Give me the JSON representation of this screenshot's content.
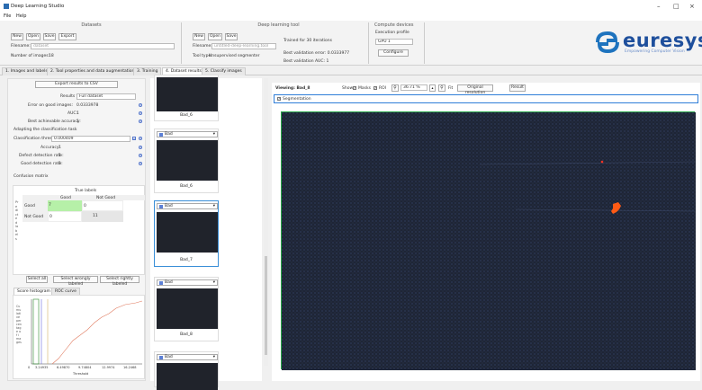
{
  "app": {
    "title": "Deep Learning Studio"
  },
  "menu": {
    "file": "File",
    "help": "Help"
  },
  "ribbon": {
    "datasets": {
      "title": "Datasets",
      "new": "New",
      "open": "Open",
      "save": "Save",
      "export": "Export",
      "filename_label": "Filename:",
      "filename_value": "dataset",
      "num_images_label": "Number of images:",
      "num_images_value": "18"
    },
    "deep": {
      "title": "Deep learning tool",
      "new": "New",
      "open": "Open",
      "save": "Save",
      "filename_label": "Filename:",
      "filename_value": "untitled-deep-learning.tool",
      "tool_type_label": "Tool type:",
      "tool_type_value": "Unsupervised segmenter",
      "trained": "Trained for 30 iterations",
      "best_error": "Best validation error: 0.0333977",
      "best_auc": "Best validation AUC: 1"
    },
    "device": {
      "title": "Compute devices",
      "exec_label": "Execution profile",
      "exec_value": "GPU 1",
      "config": "Configure"
    }
  },
  "logo": {
    "text": "euresys",
    "tagline": "Empowering Computer Vision"
  },
  "tabs": [
    "1. Images and labels",
    "2. Tool properties and data augmentation",
    "3. Training",
    "4. Dataset results",
    "5. Classify images"
  ],
  "left": {
    "export_btn": "Export results to CSV",
    "results_for_label": "Results for:",
    "results_for_value": "Full dataset",
    "err_good_label": "Error on good images:",
    "err_good_value": "0.0333978",
    "auc_label": "AUC:",
    "auc_value": "1",
    "best_score_label": "Best achievable accuracy:",
    "best_score_value": "1",
    "adapting": "Adapting the classification task",
    "thresh_label": "Classification threshold:",
    "thresh_value": "0.000409",
    "accuracy_label": "Accuracy:",
    "accuracy_value": "1",
    "ddr_label": "Defect detection rate:",
    "ddr_value": "1",
    "gdr_label": "Good detection rate:",
    "gdr_value": "1",
    "cm_title": "Confusion matrix",
    "true_labels": "True labels",
    "col_good": "Good",
    "col_notgood": "Not Good",
    "row_good": "Good",
    "row_notgood": "Not Good",
    "v_gg": "7",
    "v_gn": "0",
    "v_ng": "0",
    "v_nn": "11",
    "predicted": "Predicted labels",
    "select_all": "Select all",
    "select_wrong": "Select wrongly labeled",
    "select_right": "Select rightly labeled",
    "tab_hist": "Score histogram",
    "tab_roc": "ROC curve",
    "ylabel": "Cumulative percentage of images",
    "xticks": [
      "0",
      "3.24935",
      "6.49870",
      "9.74804",
      "12.9974",
      "16.2468"
    ],
    "xlabel": "Threshold"
  },
  "thumbs": [
    {
      "label": "Bad",
      "caption": "Bad_6"
    },
    {
      "label": "Bad",
      "caption": "Bad_7"
    },
    {
      "label": "Bad",
      "caption": "Bad_8"
    },
    {
      "label": "Bad",
      "caption": "Bad_9"
    },
    {
      "label": "Bad",
      "caption": ""
    }
  ],
  "viewer": {
    "viewing": "Viewing: Bad_8",
    "show": "Show:",
    "masks": "Masks",
    "roi": "ROI",
    "zoom": "36.71 %",
    "fit": "Fit",
    "original": "Original resolution",
    "result": "Result",
    "segmentation": "Segmentation"
  }
}
